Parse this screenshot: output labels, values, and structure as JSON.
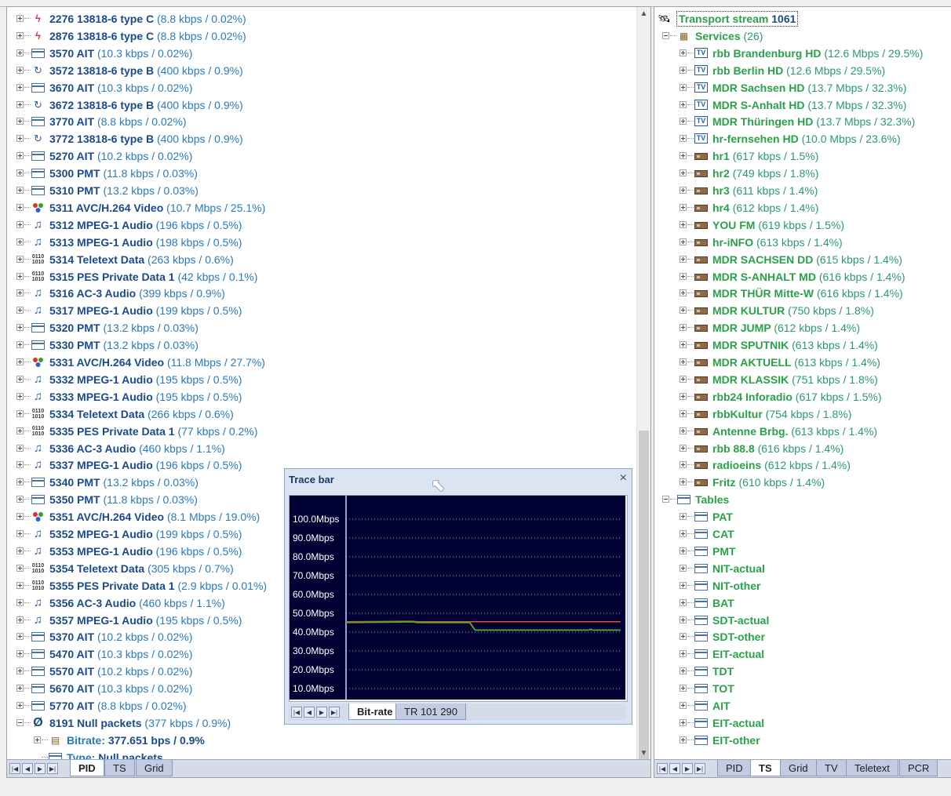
{
  "left_tree": {
    "rows": [
      {
        "icon": "flash-icon",
        "pid": "2276",
        "name": "13818-6 type C",
        "detail": "(8.8 kbps / 0.02%)"
      },
      {
        "icon": "flash-icon",
        "pid": "2876",
        "name": "13818-6 type C",
        "detail": "(8.8 kbps / 0.02%)"
      },
      {
        "icon": "table-icon",
        "pid": "3570",
        "name": "AIT",
        "detail": "(10.3 kbps / 0.02%)"
      },
      {
        "icon": "loop-icon",
        "pid": "3572",
        "name": "13818-6 type B",
        "detail": "(400 kbps / 0.9%)"
      },
      {
        "icon": "table-icon",
        "pid": "3670",
        "name": "AIT",
        "detail": "(10.3 kbps / 0.02%)"
      },
      {
        "icon": "loop-icon",
        "pid": "3672",
        "name": "13818-6 type B",
        "detail": "(400 kbps / 0.9%)"
      },
      {
        "icon": "table-icon",
        "pid": "3770",
        "name": "AIT",
        "detail": "(8.8 kbps / 0.02%)"
      },
      {
        "icon": "loop-icon",
        "pid": "3772",
        "name": "13818-6 type B",
        "detail": "(400 kbps / 0.9%)"
      },
      {
        "icon": "table-icon",
        "pid": "5270",
        "name": "AIT",
        "detail": "(10.2 kbps / 0.02%)"
      },
      {
        "icon": "table-icon",
        "pid": "5300",
        "name": "PMT",
        "detail": "(11.8 kbps / 0.03%)"
      },
      {
        "icon": "table-icon",
        "pid": "5310",
        "name": "PMT",
        "detail": "(13.2 kbps / 0.03%)"
      },
      {
        "icon": "video-icon",
        "pid": "5311",
        "name": "AVC/H.264 Video",
        "detail": "(10.7 Mbps / 25.1%)"
      },
      {
        "icon": "music-icon",
        "pid": "5312",
        "name": "MPEG-1 Audio",
        "detail": "(196 kbps / 0.5%)"
      },
      {
        "icon": "music-icon",
        "pid": "5313",
        "name": "MPEG-1 Audio",
        "detail": "(198 kbps / 0.5%)"
      },
      {
        "icon": "binary-icon",
        "pid": "5314",
        "name": "Teletext Data",
        "detail": "(263 kbps / 0.6%)"
      },
      {
        "icon": "binary-icon",
        "pid": "5315",
        "name": "PES Private Data 1",
        "detail": "(42 kbps / 0.1%)"
      },
      {
        "icon": "music-icon",
        "pid": "5316",
        "name": "AC-3 Audio",
        "detail": "(399 kbps / 0.9%)"
      },
      {
        "icon": "music-icon",
        "pid": "5317",
        "name": "MPEG-1 Audio",
        "detail": "(199 kbps / 0.5%)"
      },
      {
        "icon": "table-icon",
        "pid": "5320",
        "name": "PMT",
        "detail": "(13.2 kbps / 0.03%)"
      },
      {
        "icon": "table-icon",
        "pid": "5330",
        "name": "PMT",
        "detail": "(13.2 kbps / 0.03%)"
      },
      {
        "icon": "video-icon",
        "pid": "5331",
        "name": "AVC/H.264 Video",
        "detail": "(11.8 Mbps / 27.7%)"
      },
      {
        "icon": "music-icon",
        "pid": "5332",
        "name": "MPEG-1 Audio",
        "detail": "(195 kbps / 0.5%)"
      },
      {
        "icon": "music-icon",
        "pid": "5333",
        "name": "MPEG-1 Audio",
        "detail": "(195 kbps / 0.5%)"
      },
      {
        "icon": "binary-icon",
        "pid": "5334",
        "name": "Teletext Data",
        "detail": "(266 kbps / 0.6%)"
      },
      {
        "icon": "binary-icon",
        "pid": "5335",
        "name": "PES Private Data 1",
        "detail": "(77 kbps / 0.2%)"
      },
      {
        "icon": "music-icon",
        "pid": "5336",
        "name": "AC-3 Audio",
        "detail": "(460 kbps / 1.1%)"
      },
      {
        "icon": "music-icon",
        "pid": "5337",
        "name": "MPEG-1 Audio",
        "detail": "(196 kbps / 0.5%)"
      },
      {
        "icon": "table-icon",
        "pid": "5340",
        "name": "PMT",
        "detail": "(13.2 kbps / 0.03%)"
      },
      {
        "icon": "table-icon",
        "pid": "5350",
        "name": "PMT",
        "detail": "(11.8 kbps / 0.03%)"
      },
      {
        "icon": "video-icon",
        "pid": "5351",
        "name": "AVC/H.264 Video",
        "detail": "(8.1 Mbps / 19.0%)"
      },
      {
        "icon": "music-icon",
        "pid": "5352",
        "name": "MPEG-1 Audio",
        "detail": "(199 kbps / 0.5%)"
      },
      {
        "icon": "music-icon",
        "pid": "5353",
        "name": "MPEG-1 Audio",
        "detail": "(196 kbps / 0.5%)"
      },
      {
        "icon": "binary-icon",
        "pid": "5354",
        "name": "Teletext Data",
        "detail": "(305 kbps / 0.7%)"
      },
      {
        "icon": "binary-icon",
        "pid": "5355",
        "name": "PES Private Data 1",
        "detail": "(2.9 kbps / 0.01%)"
      },
      {
        "icon": "music-icon",
        "pid": "5356",
        "name": "AC-3 Audio",
        "detail": "(460 kbps / 1.1%)"
      },
      {
        "icon": "music-icon",
        "pid": "5357",
        "name": "MPEG-1 Audio",
        "detail": "(195 kbps / 0.5%)"
      },
      {
        "icon": "table-icon",
        "pid": "5370",
        "name": "AIT",
        "detail": "(10.2 kbps / 0.02%)"
      },
      {
        "icon": "table-icon",
        "pid": "5470",
        "name": "AIT",
        "detail": "(10.3 kbps / 0.02%)"
      },
      {
        "icon": "table-icon",
        "pid": "5570",
        "name": "AIT",
        "detail": "(10.2 kbps / 0.02%)"
      },
      {
        "icon": "table-icon",
        "pid": "5670",
        "name": "AIT",
        "detail": "(10.3 kbps / 0.02%)"
      },
      {
        "icon": "table-icon",
        "pid": "5770",
        "name": "AIT",
        "detail": "(8.8 kbps / 0.02%)"
      },
      {
        "icon": "null-icon",
        "pid": "8191",
        "name": "Null packets",
        "detail": "(377 kbps / 0.9%)",
        "expanded": true
      }
    ],
    "children": [
      {
        "key": "Bitrate:",
        "value": "377.651 bps / 0.9%",
        "icon": "bitrate-icon"
      },
      {
        "key": "Type:",
        "value": "Null packets",
        "icon": "type-icon"
      }
    ],
    "tabs": [
      "PID",
      "TS",
      "Grid"
    ],
    "active_tab": "PID"
  },
  "right_tree": {
    "root": {
      "label": "Transport stream",
      "value": "1061"
    },
    "services_label": "Services",
    "services_count": "(26)",
    "services": [
      {
        "type": "tv",
        "name": "rbb Brandenburg HD",
        "detail": "(12.6 Mbps / 29.5%)"
      },
      {
        "type": "tv",
        "name": "rbb Berlin HD",
        "detail": "(12.6 Mbps / 29.5%)"
      },
      {
        "type": "tv",
        "name": "MDR Sachsen HD",
        "detail": "(13.7 Mbps / 32.3%)"
      },
      {
        "type": "tv",
        "name": "MDR S-Anhalt HD",
        "detail": "(13.7 Mbps / 32.3%)"
      },
      {
        "type": "tv",
        "name": "MDR Thüringen HD",
        "detail": "(13.7 Mbps / 32.3%)"
      },
      {
        "type": "tv",
        "name": "hr-fernsehen HD",
        "detail": "(10.0 Mbps / 23.6%)"
      },
      {
        "type": "radio",
        "name": "hr1",
        "detail": "(617 kbps / 1.5%)"
      },
      {
        "type": "radio",
        "name": "hr2",
        "detail": "(749 kbps / 1.8%)"
      },
      {
        "type": "radio",
        "name": "hr3",
        "detail": "(611 kbps / 1.4%)"
      },
      {
        "type": "radio",
        "name": "hr4",
        "detail": "(612 kbps / 1.4%)"
      },
      {
        "type": "radio",
        "name": "YOU FM",
        "detail": "(619 kbps / 1.5%)"
      },
      {
        "type": "radio",
        "name": "hr-iNFO",
        "detail": "(613 kbps / 1.4%)"
      },
      {
        "type": "radio",
        "name": "MDR SACHSEN DD",
        "detail": "(615 kbps / 1.4%)"
      },
      {
        "type": "radio",
        "name": "MDR S-ANHALT MD",
        "detail": "(616 kbps / 1.4%)"
      },
      {
        "type": "radio",
        "name": "MDR THÜR Mitte-W",
        "detail": "(616 kbps / 1.4%)"
      },
      {
        "type": "radio",
        "name": "MDR KULTUR",
        "detail": "(750 kbps / 1.8%)"
      },
      {
        "type": "radio",
        "name": "MDR JUMP",
        "detail": "(612 kbps / 1.4%)"
      },
      {
        "type": "radio",
        "name": "MDR SPUTNIK",
        "detail": "(613 kbps / 1.4%)"
      },
      {
        "type": "radio",
        "name": "MDR AKTUELL",
        "detail": "(613 kbps / 1.4%)"
      },
      {
        "type": "radio",
        "name": "MDR KLASSIK",
        "detail": "(751 kbps / 1.8%)"
      },
      {
        "type": "radio",
        "name": "rbb24 Inforadio",
        "detail": "(617 kbps / 1.5%)"
      },
      {
        "type": "radio",
        "name": "rbbKultur",
        "detail": "(754 kbps / 1.8%)"
      },
      {
        "type": "radio",
        "name": "Antenne Brbg.",
        "detail": "(613 kbps / 1.4%)"
      },
      {
        "type": "radio",
        "name": "rbb 88.8",
        "detail": "(616 kbps / 1.4%)"
      },
      {
        "type": "radio",
        "name": "radioeins",
        "detail": "(612 kbps / 1.4%)"
      },
      {
        "type": "radio",
        "name": "Fritz",
        "detail": "(610 kbps / 1.4%)"
      }
    ],
    "tables_label": "Tables",
    "tables": [
      "PAT",
      "CAT",
      "PMT",
      "NIT-actual",
      "NIT-other",
      "BAT",
      "SDT-actual",
      "SDT-other",
      "EIT-actual",
      "TDT",
      "TOT",
      "AIT",
      "EIT-actual",
      "EIT-other"
    ],
    "tabs": [
      "PID",
      "TS",
      "Grid",
      "TV",
      "Teletext",
      "PCR"
    ],
    "active_tab": "TS"
  },
  "trace_bar": {
    "title": "Trace bar",
    "close": "×",
    "tabs": [
      "Bit-rate",
      "TR 101 290"
    ],
    "active_tab": "Bit-rate"
  },
  "chart_data": {
    "type": "line",
    "ytick_labels": [
      "100.0Mbps",
      "90.0Mbps",
      "80.0Mbps",
      "70.0Mbps",
      "60.0Mbps",
      "50.0Mbps",
      "40.0Mbps",
      "30.0Mbps",
      "20.0Mbps",
      "10.0Mbps"
    ],
    "ylim": [
      0,
      100
    ],
    "xlim": [
      0,
      100
    ],
    "grid": true,
    "background": "#000033",
    "series": [
      {
        "color": "#e05030",
        "x": [
          0,
          24,
          26,
          45,
          100
        ],
        "y": [
          45.5,
          45.8,
          45.5,
          45.5,
          45.5
        ],
        "x2": [
          45,
          47,
          100
        ],
        "y2": [
          45.5,
          41.2,
          41.2
        ]
      },
      {
        "color": "#30c030",
        "x": [
          0,
          24,
          26,
          45,
          47,
          88,
          89,
          90,
          100
        ],
        "y": [
          45.0,
          45.4,
          45.0,
          45.0,
          41.0,
          41.0,
          41.5,
          41.0,
          41.0
        ]
      }
    ]
  },
  "colors": {
    "accent": "#1a4a8a",
    "service": "#2aa04a",
    "detail": "#2a7ab8"
  }
}
